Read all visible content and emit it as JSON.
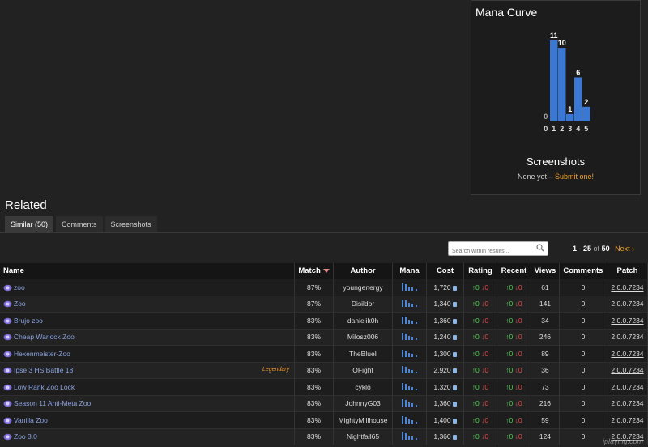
{
  "mana_curve": {
    "title": "Mana Curve",
    "chart_data": {
      "type": "bar",
      "categories": [
        "0",
        "1",
        "2",
        "3",
        "4",
        "5"
      ],
      "values": [
        0,
        11,
        10,
        1,
        6,
        2
      ],
      "ylim": [
        0,
        11
      ],
      "grid": false,
      "legend": "none",
      "color": "#3a78d4"
    }
  },
  "screenshots": {
    "title": "Screenshots",
    "none_text": "None yet – ",
    "submit_link": "Submit one!"
  },
  "related": {
    "title": "Related",
    "tabs": [
      "Similar (50)",
      "Comments",
      "Screenshots"
    ],
    "search_placeholder": "Search within results...",
    "pager": {
      "from": "1",
      "to": "25",
      "of_label": "of",
      "total": "50",
      "next_label": "Next ›"
    },
    "columns": [
      "Name",
      "Match",
      "Author",
      "Mana",
      "Cost",
      "Rating",
      "Recent",
      "Views",
      "Comments",
      "Patch"
    ],
    "rows": [
      {
        "name": "zoo",
        "tag": "",
        "match": "87%",
        "author": "youngenergy",
        "cost": "1,720",
        "rating_up": "0",
        "rating_down": "0",
        "recent_up": "0",
        "recent_down": "0",
        "views": "61",
        "comments": "0",
        "patch": "2.0.0.7234",
        "patch_current": false
      },
      {
        "name": "Zoo",
        "tag": "",
        "match": "87%",
        "author": "Disildor",
        "cost": "1,340",
        "rating_up": "0",
        "rating_down": "0",
        "recent_up": "0",
        "recent_down": "0",
        "views": "141",
        "comments": "0",
        "patch": "2.0.0.7234",
        "patch_current": true
      },
      {
        "name": "Brujo zoo",
        "tag": "",
        "match": "83%",
        "author": "danielik0h",
        "cost": "1,360",
        "rating_up": "0",
        "rating_down": "0",
        "recent_up": "0",
        "recent_down": "0",
        "views": "34",
        "comments": "0",
        "patch": "2.0.0.7234",
        "patch_current": false
      },
      {
        "name": "Cheap Warlock Zoo",
        "tag": "",
        "match": "83%",
        "author": "Milosz006",
        "cost": "1,240",
        "rating_up": "0",
        "rating_down": "0",
        "recent_up": "0",
        "recent_down": "0",
        "views": "246",
        "comments": "0",
        "patch": "2.0.0.7234",
        "patch_current": true
      },
      {
        "name": "Hexenmeister-Zoo",
        "tag": "",
        "match": "83%",
        "author": "TheBlueI",
        "cost": "1,300",
        "rating_up": "0",
        "rating_down": "0",
        "recent_up": "0",
        "recent_down": "0",
        "views": "89",
        "comments": "0",
        "patch": "2.0.0.7234",
        "patch_current": false
      },
      {
        "name": "Ipse 3 HS Battle 18",
        "tag": "Legendary",
        "match": "83%",
        "author": "OFight",
        "cost": "2,920",
        "rating_up": "0",
        "rating_down": "0",
        "recent_up": "0",
        "recent_down": "0",
        "views": "36",
        "comments": "0",
        "patch": "2.0.0.7234",
        "patch_current": false
      },
      {
        "name": "Low Rank Zoo Lock",
        "tag": "",
        "match": "83%",
        "author": "cyklo",
        "cost": "1,320",
        "rating_up": "0",
        "rating_down": "0",
        "recent_up": "0",
        "recent_down": "0",
        "views": "73",
        "comments": "0",
        "patch": "2.0.0.7234",
        "patch_current": true
      },
      {
        "name": "Season 11 Anti-Meta Zoo",
        "tag": "",
        "match": "83%",
        "author": "JohnnyG03",
        "cost": "1,360",
        "rating_up": "0",
        "rating_down": "0",
        "recent_up": "0",
        "recent_down": "0",
        "views": "216",
        "comments": "0",
        "patch": "2.0.0.7234",
        "patch_current": true
      },
      {
        "name": "Vanilla Zoo",
        "tag": "",
        "match": "83%",
        "author": "MightyMillhouse",
        "cost": "1,400",
        "rating_up": "0",
        "rating_down": "0",
        "recent_up": "0",
        "recent_down": "0",
        "views": "59",
        "comments": "0",
        "patch": "2.0.0.7234",
        "patch_current": true
      },
      {
        "name": "Zoo 3.0",
        "tag": "",
        "match": "83%",
        "author": "Nightfall65",
        "cost": "1,360",
        "rating_up": "0",
        "rating_down": "0",
        "recent_up": "0",
        "recent_down": "0",
        "views": "124",
        "comments": "0",
        "patch": "2.0.0.7234",
        "patch_current": false
      }
    ]
  },
  "watermark": "iplaying.com"
}
